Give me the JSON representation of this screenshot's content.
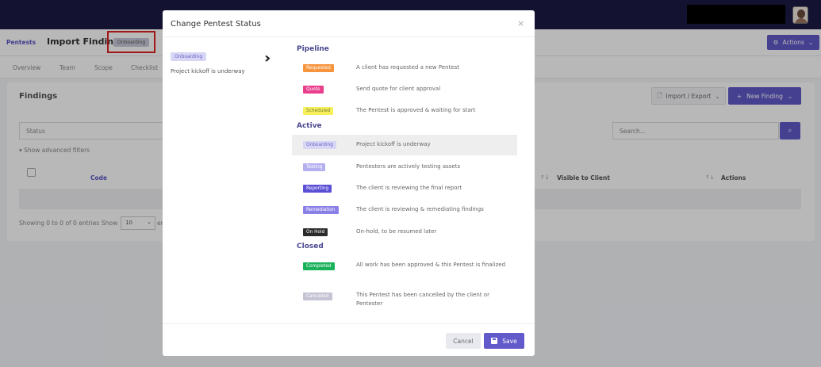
{
  "topbar": {
    "avatar": "user-avatar"
  },
  "header": {
    "breadcrumb": "Pentests",
    "title": "Import Findings",
    "status_chip": "Onboarding",
    "actions_label": "Actions"
  },
  "tabs": [
    "Overview",
    "Team",
    "Scope",
    "Checklist"
  ],
  "findings": {
    "title": "Findings",
    "import_export": "Import / Export",
    "new_finding": "New Finding",
    "status_placeholder": "Status",
    "search_placeholder": "Search...",
    "advanced_filters": "Show advanced filters",
    "col_code": "Code",
    "col_visible": "Visible to Client",
    "col_actions": "Actions",
    "showing": "Showing 0 to 0 of 0 entries",
    "show_label": "Show",
    "show_value": "10",
    "entries_partial": "er"
  },
  "modal": {
    "title": "Change Pentest Status",
    "close": "×",
    "current_status": "Onboarding",
    "current_desc": "Project kickoff is underway",
    "groups": {
      "pipeline": "Pipeline",
      "active": "Active",
      "closed": "Closed"
    },
    "statuses": {
      "requested": {
        "label": "Requested",
        "desc": "A client has requested a new Pentest",
        "bg": "#f7943e",
        "fg": "#ffffff"
      },
      "quote": {
        "label": "Quote",
        "desc": "Send quote for client approval",
        "bg": "#e83e8c",
        "fg": "#ffffff"
      },
      "scheduled": {
        "label": "Scheduled",
        "desc": "The Pentest is approved & waiting for start",
        "bg": "#f5f05c",
        "fg": "#7a7a30"
      },
      "onboarding": {
        "label": "Onboarding",
        "desc": "Project kickoff is underway",
        "bg": "#d8d6f5",
        "fg": "#6a64c8"
      },
      "testing": {
        "label": "Testing",
        "desc": "Pentesters are actively testing assets",
        "bg": "#b4b0f0",
        "fg": "#ffffff"
      },
      "reporting": {
        "label": "Reporting",
        "desc": "The client is reviewing the final report",
        "bg": "#5b4fd6",
        "fg": "#ffffff"
      },
      "remediation": {
        "label": "Remediation",
        "desc": "The client is reviewing & remediating findings",
        "bg": "#8b80e6",
        "fg": "#ffffff"
      },
      "onhold": {
        "label": "On Hold",
        "desc": "On-hold, to be resumed later",
        "bg": "#2b2b2b",
        "fg": "#ffffff"
      },
      "completed": {
        "label": "Completed",
        "desc": "All work has been approved & this Pentest is finalized",
        "bg": "#19b159",
        "fg": "#ffffff"
      },
      "cancelled": {
        "label": "Cancelled",
        "desc": "This Pentest has been cancelled by the client or Pentester",
        "bg": "#c4c4d4",
        "fg": "#ffffff"
      }
    },
    "cancel": "Cancel",
    "save": "Save"
  }
}
